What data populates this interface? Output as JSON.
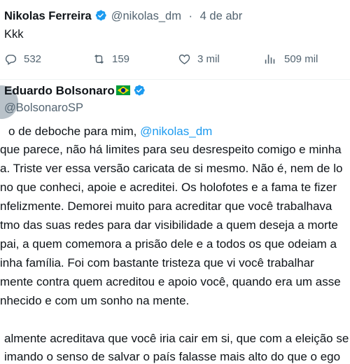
{
  "tweet1": {
    "name": "Nikolas Ferreira",
    "handle": "@nikolas_dm",
    "separator": "·",
    "date": "4 de abr",
    "text": "Kkk",
    "actions": {
      "replies": "532",
      "retweets": "159",
      "likes": "3 mil",
      "views": "509 mil"
    },
    "icons": [
      "verified-badge-icon",
      "reply-icon",
      "retweet-icon",
      "like-icon",
      "views-icon"
    ]
  },
  "tweet2": {
    "name": "Eduardo Bolsonaro",
    "flag": "brazil-flag-icon",
    "handle": "@BolsonaroSP",
    "lines": [
      {
        "text": "o de deboche para mim, ",
        "mention": "@nikolas_dm"
      },
      {
        "text": "que parece, não há limites para seu desrespeito comigo e minha"
      },
      {
        "text": "a. Triste ver essa versão caricata de si mesmo. Não é, nem de lo"
      },
      {
        "text": "no que conheci, apoie e acreditei. Os holofotes e a fama te fizer"
      },
      {
        "text": "nfelizmente. Demorei muito para acreditar que você trabalhava"
      },
      {
        "text": "tmo das suas redes para dar visibilidade a quem deseja a morte"
      },
      {
        "text": "pai, a quem comemora a prisão dele e a todos os que odeiam a"
      },
      {
        "text": "inha família. Foi com bastante tristeza que vi você trabalhar"
      },
      {
        "text": "mente contra quem acreditou e apoio você, quando era um asse"
      },
      {
        "text": "nhecido e com um sonho na mente."
      },
      {
        "text": "almente acreditava que você iria cair em si, que com a eleição se"
      },
      {
        "text": "imando o senso de salvar o país falasse mais alto do que o ego"
      }
    ]
  },
  "colors": {
    "text": "#0f1419",
    "secondary": "#536471",
    "link": "#1d9bf0",
    "verified": "#1d9bf0"
  }
}
